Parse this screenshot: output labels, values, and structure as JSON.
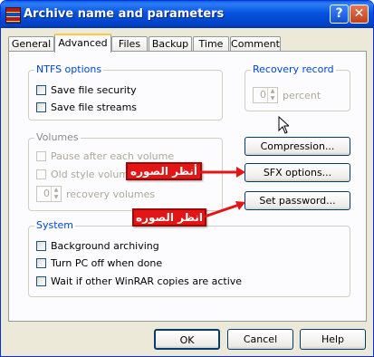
{
  "window": {
    "title": "Archive name and parameters",
    "help_glyph": "?",
    "close_glyph": "✕"
  },
  "tabs": [
    {
      "label": "General",
      "active": false
    },
    {
      "label": "Advanced",
      "active": true
    },
    {
      "label": "Files",
      "active": false
    },
    {
      "label": "Backup",
      "active": false
    },
    {
      "label": "Time",
      "active": false
    },
    {
      "label": "Comment",
      "active": false
    }
  ],
  "ntfs": {
    "legend": "NTFS options",
    "items": [
      {
        "label": "Save file security",
        "checked": false
      },
      {
        "label": "Save file streams",
        "checked": false
      }
    ]
  },
  "recovery": {
    "legend": "Recovery record",
    "value": "0",
    "unit": "percent"
  },
  "volumes": {
    "legend": "Volumes",
    "items": [
      {
        "label": "Pause after each volume",
        "checked": false
      },
      {
        "label": "Old style volume names",
        "checked": false
      }
    ],
    "recovery_value": "0",
    "recovery_label": "recovery volumes"
  },
  "side_buttons": {
    "compression": "Compression...",
    "sfx": "SFX options...",
    "password": "Set password..."
  },
  "annotations": {
    "first": "أنظر الصوره",
    "second": "انظر الصوره"
  },
  "system": {
    "legend": "System",
    "items": [
      {
        "label": "Background archiving",
        "checked": false
      },
      {
        "label": "Turn PC off when done",
        "checked": false
      },
      {
        "label": "Wait if other WinRAR copies are active",
        "checked": false
      }
    ]
  },
  "footer": {
    "ok": "OK",
    "cancel": "Cancel",
    "help": "Help"
  }
}
